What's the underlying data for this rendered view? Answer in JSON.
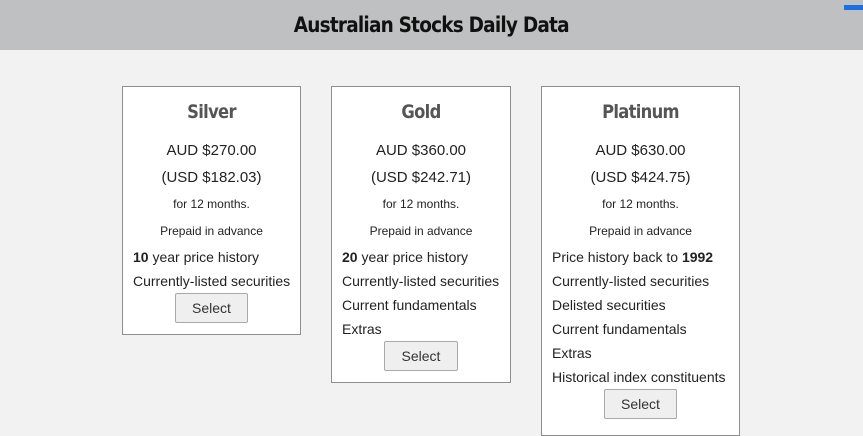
{
  "header": {
    "title": "Australian Stocks Daily Data"
  },
  "plans": [
    {
      "name": "Silver",
      "price_aud": "AUD $270.00",
      "price_usd": "(USD $182.03)",
      "term": "for 12 months.",
      "billing": "Prepaid in advance",
      "features": [
        {
          "bold": "10",
          "text": " year price history"
        },
        {
          "bold": "",
          "text": "Currently-listed securities"
        }
      ],
      "button": "Select"
    },
    {
      "name": "Gold",
      "price_aud": "AUD $360.00",
      "price_usd": "(USD $242.71)",
      "term": "for 12 months.",
      "billing": "Prepaid in advance",
      "features": [
        {
          "bold": "20",
          "text": " year price history"
        },
        {
          "bold": "",
          "text": "Currently-listed securities"
        },
        {
          "bold": "",
          "text": "Current fundamentals"
        },
        {
          "bold": "",
          "text": "Extras"
        }
      ],
      "button": "Select"
    },
    {
      "name": "Platinum",
      "price_aud": "AUD $630.00",
      "price_usd": "(USD $424.75)",
      "term": "for 12 months.",
      "billing": "Prepaid in advance",
      "features": [
        {
          "prefix": "Price history back to ",
          "bold": "1992",
          "text": ""
        },
        {
          "bold": "",
          "text": "Currently-listed securities"
        },
        {
          "bold": "",
          "text": "Delisted securities"
        },
        {
          "bold": "",
          "text": "Current fundamentals"
        },
        {
          "bold": "",
          "text": "Extras"
        },
        {
          "bold": "",
          "text": "Historical index constituents"
        }
      ],
      "button": "Select"
    }
  ]
}
